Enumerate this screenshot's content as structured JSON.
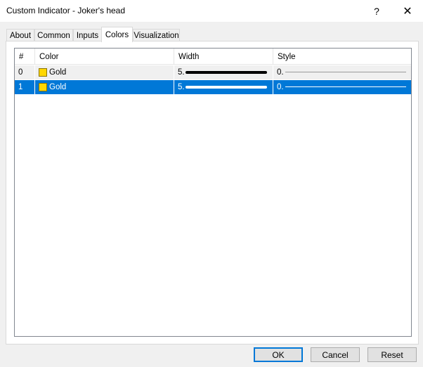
{
  "window": {
    "title": "Custom Indicator - Joker's head",
    "help_glyph": "?",
    "close_glyph": "✕"
  },
  "tabs": [
    {
      "label": "About",
      "active": false
    },
    {
      "label": "Common",
      "active": false
    },
    {
      "label": "Inputs",
      "active": false
    },
    {
      "label": "Colors",
      "active": true
    },
    {
      "label": "Visualization",
      "active": false
    }
  ],
  "table": {
    "columns": [
      "#",
      "Color",
      "Width",
      "Style"
    ],
    "rows": [
      {
        "index": "0",
        "color_name": "Gold",
        "color_hex": "#ffd700",
        "width": "5.",
        "style": "0.",
        "selected": false
      },
      {
        "index": "1",
        "color_name": "Gold",
        "color_hex": "#ffd700",
        "width": "5.",
        "style": "0.",
        "selected": true
      }
    ]
  },
  "buttons": {
    "ok": "OK",
    "cancel": "Cancel",
    "reset": "Reset"
  },
  "colors": {
    "selection": "#0078d7",
    "gold": "#ffd700",
    "line_normal": "#000000",
    "line_selected": "#ffffff"
  }
}
